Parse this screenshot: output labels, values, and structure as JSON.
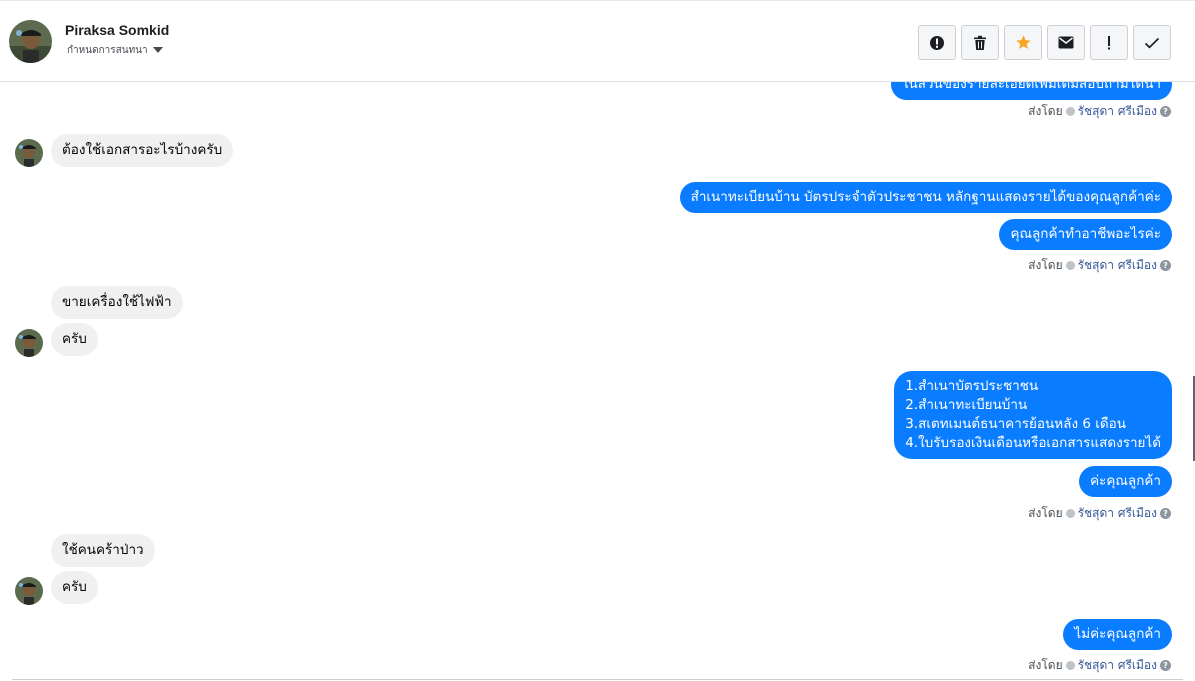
{
  "contact": {
    "name": "Piraksa Somkid",
    "status": "กำหนดการสนทนา"
  },
  "toolbar": {
    "buttons": [
      {
        "name": "report-button",
        "icon": "exclamation-circle-icon"
      },
      {
        "name": "delete-button",
        "icon": "trash-icon"
      },
      {
        "name": "star-button",
        "icon": "star-icon",
        "color": "#f5a623"
      },
      {
        "name": "mark-unread-button",
        "icon": "envelope-icon"
      },
      {
        "name": "important-button",
        "icon": "exclamation-icon"
      },
      {
        "name": "done-button",
        "icon": "checkmark-icon"
      }
    ]
  },
  "colors": {
    "outgoing_bubble": "#0a7cff",
    "incoming_bubble": "#f0f0f0",
    "agent_link": "#385898"
  },
  "messages": {
    "m0": "ในส่วนของรายละเอียดเพิ่มเติมสอบถามได้นา",
    "sent0": {
      "prefix": "ส่งโดย",
      "agent": "รัชสุดา ศรีเมือง"
    },
    "m1": "ต้องใช้เอกสารอะไรบ้างครับ",
    "m2": "สำเนาทะเบียนบ้าน บัตรประจำตัวประชาชน หลักฐานแสดงรายได้ของคุณลูกค้าค่ะ",
    "m3": "คุณลูกค้าทำอาชีพอะไรค่ะ",
    "sent1": {
      "prefix": "ส่งโดย",
      "agent": "รัชสุดา ศรีเมือง"
    },
    "m4": "ขายเครื่องใช้ไฟฟ้า",
    "m5": "ครับ",
    "m6": [
      "1.สำเนาบัตรประชาชน",
      "2.สำเนาทะเบียนบ้าน",
      "3.สเตทเมนต์ธนาคารย้อนหลัง 6 เดือน",
      "4.ใบรับรองเงินเดือนหรือเอกสารแสดงรายได้"
    ],
    "m7": "ค่ะคุณลูกค้า",
    "sent2": {
      "prefix": "ส่งโดย",
      "agent": "รัชสุดา ศรีเมือง"
    },
    "m8": "ใช้คนคร้าป่าว",
    "m9": "ครับ",
    "m10": "ไม่ค่ะคุณลูกค้า",
    "sent3": {
      "prefix": "ส่งโดย",
      "agent": "รัชสุดา ศรีเมือง"
    }
  }
}
